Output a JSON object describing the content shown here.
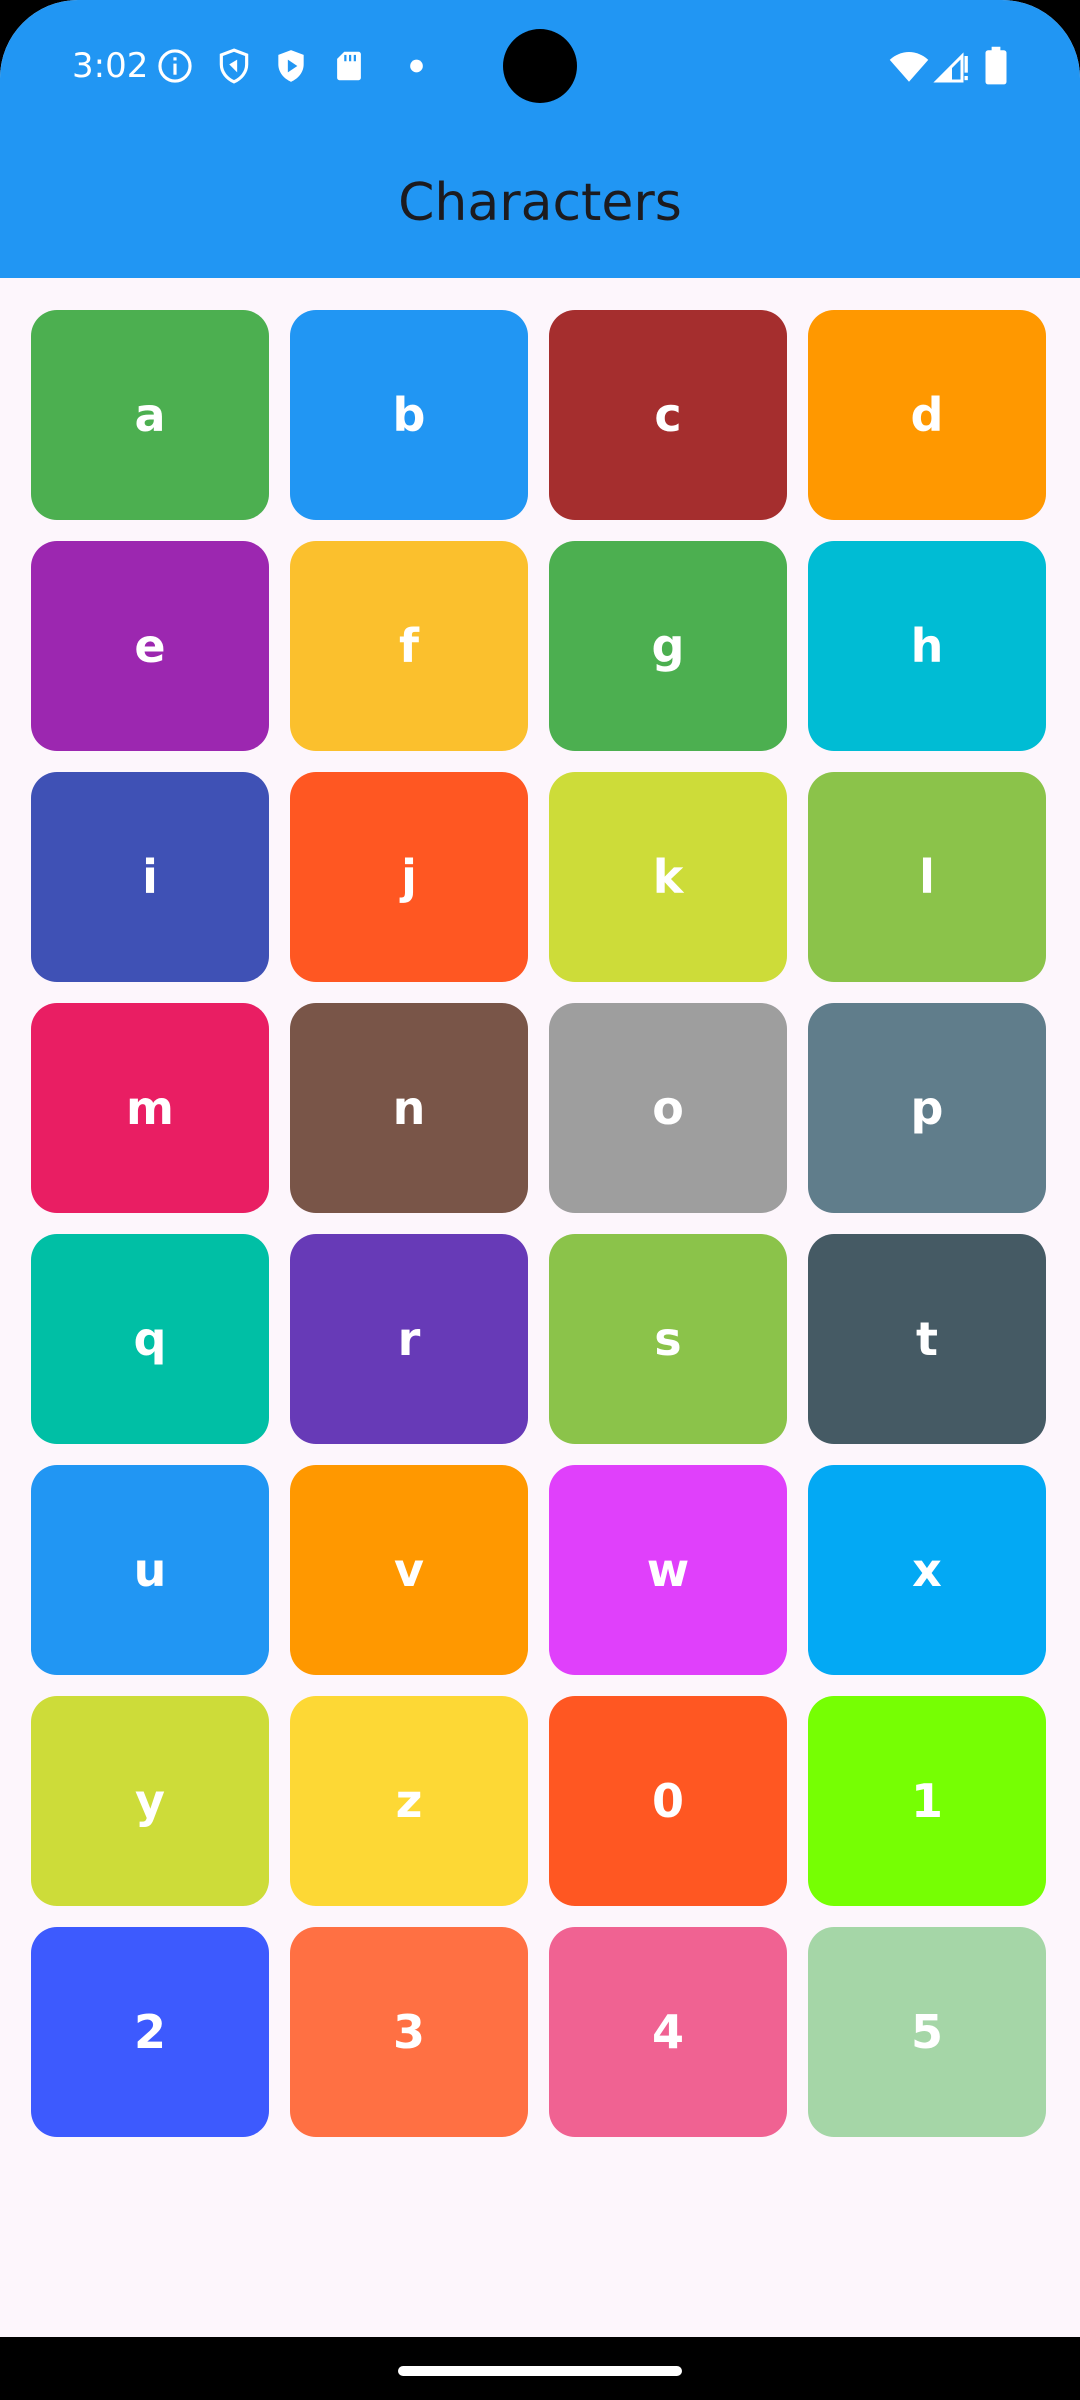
{
  "status_bar": {
    "time": "3:02",
    "left_icons": [
      "info-icon",
      "shield-icon",
      "play-protect-icon",
      "sd-card-icon",
      "notification-dot-icon"
    ],
    "right_icons": [
      "wifi-icon",
      "signal-icon",
      "battery-icon"
    ]
  },
  "app_bar": {
    "title": "Characters",
    "background_color": "#2196f3"
  },
  "tiles": [
    {
      "char": "a",
      "color": "#4caf50"
    },
    {
      "char": "b",
      "color": "#2196f3"
    },
    {
      "char": "c",
      "color": "#a52e2e"
    },
    {
      "char": "d",
      "color": "#ff9800"
    },
    {
      "char": "e",
      "color": "#9c27b0"
    },
    {
      "char": "f",
      "color": "#fbc02d"
    },
    {
      "char": "g",
      "color": "#4caf50"
    },
    {
      "char": "h",
      "color": "#00bcd4"
    },
    {
      "char": "i",
      "color": "#3f51b5"
    },
    {
      "char": "j",
      "color": "#ff5722"
    },
    {
      "char": "k",
      "color": "#cddc39"
    },
    {
      "char": "l",
      "color": "#8bc34a"
    },
    {
      "char": "m",
      "color": "#e91e63"
    },
    {
      "char": "n",
      "color": "#795548"
    },
    {
      "char": "o",
      "color": "#9e9e9e"
    },
    {
      "char": "p",
      "color": "#607d8b"
    },
    {
      "char": "q",
      "color": "#00bfa5"
    },
    {
      "char": "r",
      "color": "#673ab7"
    },
    {
      "char": "s",
      "color": "#8bc34a"
    },
    {
      "char": "t",
      "color": "#455a64"
    },
    {
      "char": "u",
      "color": "#2196f3"
    },
    {
      "char": "v",
      "color": "#ff9800"
    },
    {
      "char": "w",
      "color": "#e040fb"
    },
    {
      "char": "x",
      "color": "#03a9f4"
    },
    {
      "char": "y",
      "color": "#cddc39"
    },
    {
      "char": "z",
      "color": "#fdd835"
    },
    {
      "char": "0",
      "color": "#ff5722"
    },
    {
      "char": "1",
      "color": "#76ff03"
    },
    {
      "char": "2",
      "color": "#3d5afe"
    },
    {
      "char": "3",
      "color": "#ff7043"
    },
    {
      "char": "4",
      "color": "#f06292"
    },
    {
      "char": "5",
      "color": "#a5d6a7"
    }
  ]
}
